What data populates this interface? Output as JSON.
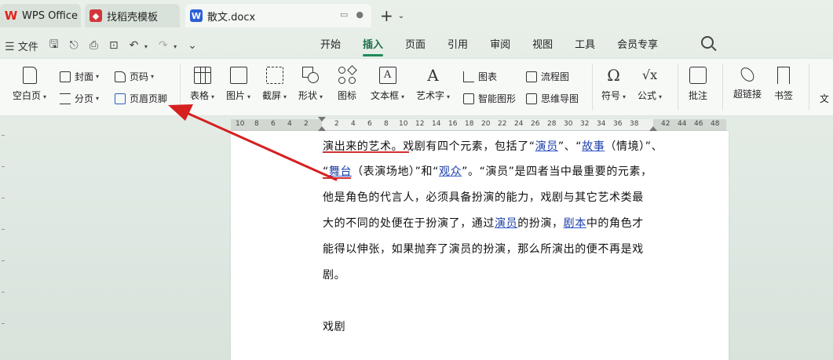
{
  "tabs": [
    {
      "label": "WPS Office",
      "icon": "wps-logo-icon"
    },
    {
      "label": "找稻壳模板",
      "icon": "docer-icon"
    },
    {
      "label": "散文.docx",
      "icon": "word-doc-icon"
    }
  ],
  "menubar": {
    "file": "文件",
    "items": [
      "开始",
      "插入",
      "页面",
      "引用",
      "审阅",
      "视图",
      "工具",
      "会员专享"
    ],
    "active": "插入"
  },
  "ribbon": {
    "blank_page": "空白页",
    "cover": "封面",
    "page_break": "分页",
    "page_number": "页码",
    "header_footer": "页眉页脚",
    "table": "表格",
    "picture": "图片",
    "screenshot": "截屏",
    "shape": "形状",
    "icon": "图标",
    "textbox": "文本框",
    "wordart": "艺术字",
    "chart": "图表",
    "smart_graphic": "智能图形",
    "flowchart": "流程图",
    "mindmap": "思维导图",
    "symbol": "符号",
    "formula": "公式",
    "comment": "批注",
    "hyperlink": "超链接",
    "bookmark": "书签",
    "cut_off": "文"
  },
  "ruler": {
    "left_numbers": [
      "10",
      "8",
      "6",
      "4",
      "2"
    ],
    "right_numbers": [
      "2",
      "4",
      "6",
      "8",
      "10",
      "12",
      "14",
      "16",
      "18",
      "20",
      "22",
      "24",
      "26",
      "28",
      "30",
      "32",
      "34",
      "36",
      "38",
      "42",
      "44",
      "46",
      "48"
    ]
  },
  "document": {
    "line1": {
      "a": "演出来的艺术。戏剧有四个元素，包括了“",
      "b": "演员",
      "c": "”、“",
      "d": "故事",
      "e": "（情境）”、"
    },
    "line2": {
      "a": "“",
      "b": "舞台",
      "c": "（表演场地）”和“",
      "d": "观众",
      "e": "”。“演员”是四者当中最重要的元素，"
    },
    "line3": "他是角色的代言人，必须具备扮演的能力，戏剧与其它艺术类最",
    "line4": {
      "a": "大的不同的处便在于扮演了，通过",
      "b": "演员",
      "c": "的扮演，",
      "d": "剧本",
      "e": "中的角色才"
    },
    "line5": "能得以伸张，如果抛弃了演员的扮演，那么所演出的便不再是戏",
    "line6": "剧。",
    "line7": "戏剧"
  },
  "colors": {
    "accent": "#1f8a5a",
    "arrow": "#d62020",
    "link": "#1c3fa8"
  }
}
